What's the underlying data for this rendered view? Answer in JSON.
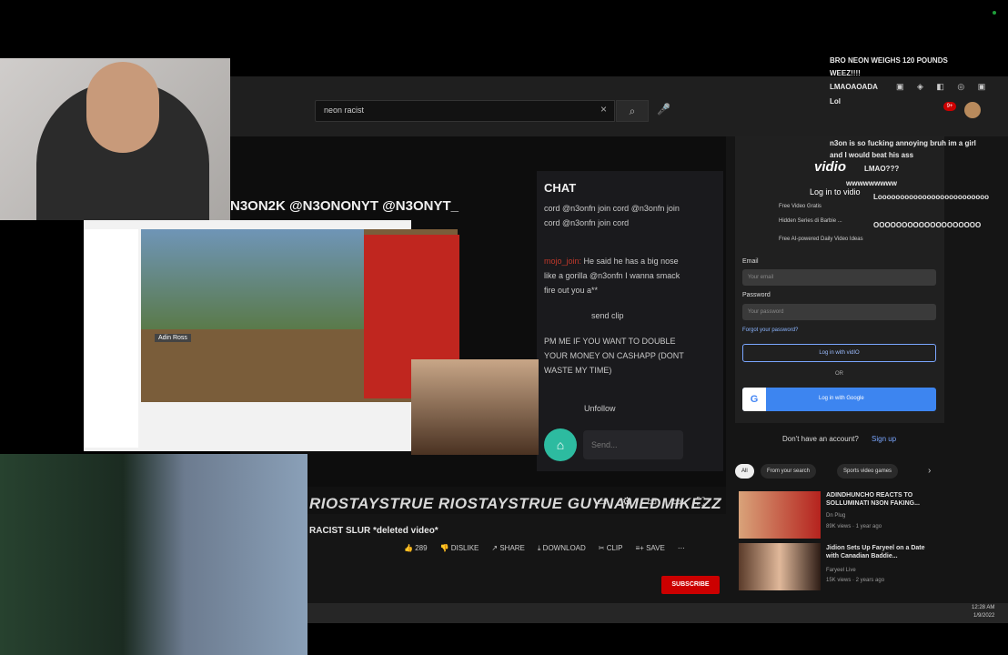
{
  "search": {
    "query": "neon racist",
    "clear": "×",
    "button": "⌕",
    "mic": "🎤"
  },
  "social": {
    "top_text": "N3ON2K  @N3ONONYT  @N3ONYT_",
    "bottom_text": "RIOSTAYSTRUE   RIOSTAYSTRUE   GUYNAMEDMIKEZZ"
  },
  "video": {
    "title": "RACIST SLUR *deleted video*"
  },
  "actions": {
    "like": "👍 289",
    "dislike": "👎 DISLIKE",
    "share": "↗ SHARE",
    "download": "⤓ DOWNLOAD",
    "clip": "✂ CLIP",
    "save": "≡+ SAVE",
    "more": "⋯"
  },
  "subscribe_label": "SUBSCRIBE",
  "player_controls": [
    "▭",
    "⚙",
    "▭",
    "▭",
    "⛶"
  ],
  "chat": {
    "title": "CHAT",
    "messages": [
      {
        "user": "",
        "text": "cord @n3onfn join cord @n3onfn join cord @n3onfn join cord"
      },
      {
        "user": "mojo_join:",
        "text": "He said he has a big nose like a gorilla @n3onfn I wanna smack fire out you a**"
      },
      {
        "user": "",
        "text": "send clip"
      },
      {
        "user": "",
        "text": "PM ME IF YOU WANT TO DOUBLE YOUR MONEY ON CASHAPP (DONT WASTE MY TIME)"
      },
      {
        "user": "",
        "text": "Unfollow"
      }
    ],
    "input_placeholder": "Send..."
  },
  "nested": {
    "streamer_label": "Adin Ross"
  },
  "sidebar": {
    "logo": "vidio",
    "login_title": "Log in to vidio",
    "perks": [
      "Free Video Gratis",
      "Hidden Series di Barbie ...",
      "Free AI-powered Daily Video Ideas"
    ],
    "email_label": "Email",
    "email_placeholder": "Your email",
    "password_label": "Password",
    "password_placeholder": "Your password",
    "forgot": "Forgot your password?",
    "login_button": "Log in with vidIO",
    "or": "OR",
    "google_button": "Log in with Google",
    "google_g": "G",
    "no_account": "Don't have an account?",
    "signup": "Sign up"
  },
  "chips": [
    "All",
    "From your search",
    "Sports video games"
  ],
  "recommended": [
    {
      "title": "ADINDHUNCHO REACTS TO SOLLUMINATI N3ON FAKING...",
      "channel": "Dn Plug",
      "meta": "89K views · 1 year ago"
    },
    {
      "title": "Jidion Sets Up Faryeel on a Date with Canadian Baddie...",
      "channel": "Faryeel Live",
      "meta": "15K views · 2 years ago"
    }
  ],
  "overlay_chat": [
    "BRO NEON WEIGHS 120 POUNDS",
    "WEEZ!!!!",
    "LMAOAOADA",
    "Lol",
    "n3on is so fucking annoying bruh im a girl",
    "and I would beat his ass",
    "LMAO???",
    "wwwwwwwww",
    "Looooooooooooooooooooooooo",
    "OOOOOOOOOOOOOOOOOOO"
  ],
  "clock": {
    "time": "12:28 AM",
    "date": "1/9/2022"
  }
}
